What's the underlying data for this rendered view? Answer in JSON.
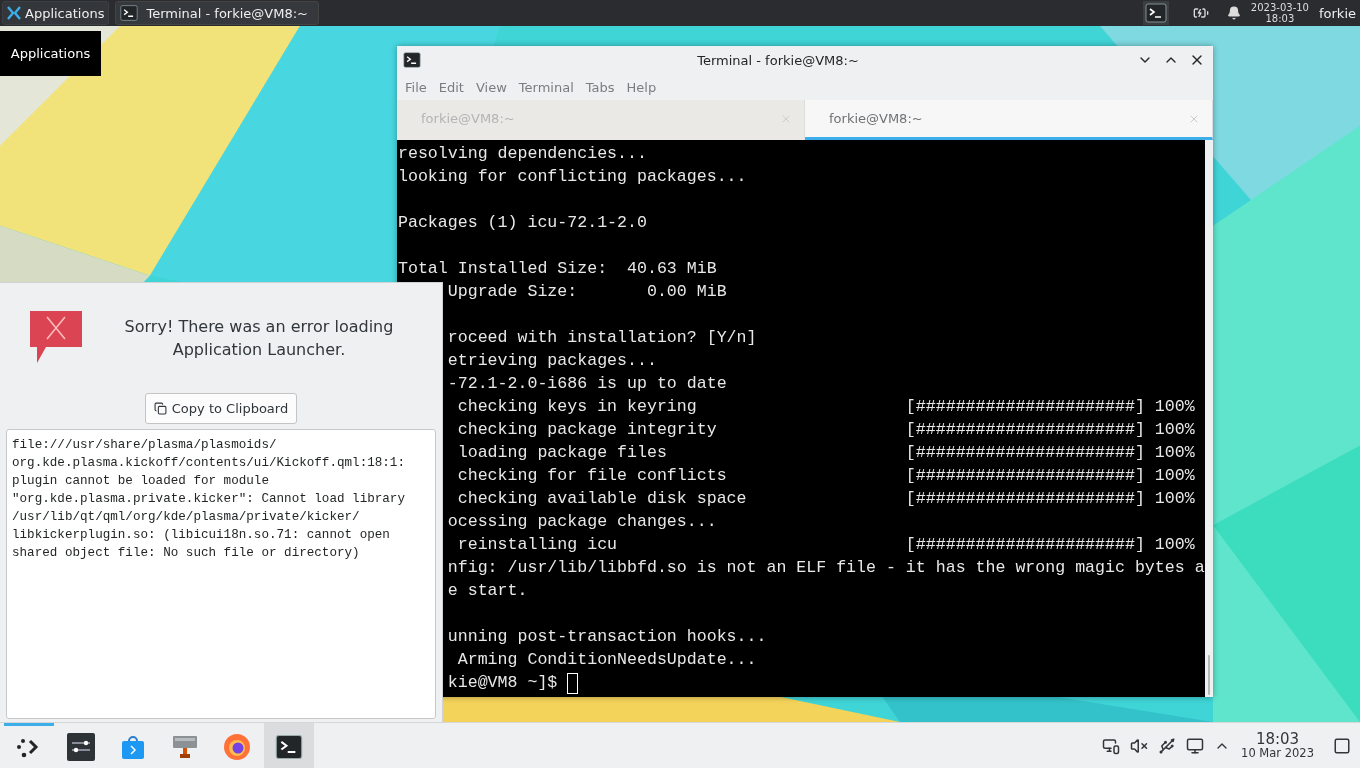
{
  "top_panel": {
    "app_menu": {
      "label": "Applications"
    },
    "tasks": [
      {
        "label": "Terminal - forkie@VM8:~",
        "selected": false
      }
    ],
    "tray_terminal": {
      "selected": true
    },
    "clock": {
      "date": "2023-03-10",
      "time": "18:03"
    },
    "user": "forkie"
  },
  "tooltip": {
    "text": "Applications"
  },
  "terminal_window": {
    "title": "Terminal - forkie@VM8:~",
    "menu": [
      "File",
      "Edit",
      "View",
      "Terminal",
      "Tabs",
      "Help"
    ],
    "tabs": [
      {
        "label": "forkie@VM8:~",
        "selected": false
      },
      {
        "label": "forkie@VM8:~",
        "selected": true
      }
    ],
    "output_blocks": [
      [
        "resolving dependencies...",
        "looking for conflicting packages..."
      ],
      [
        "Packages (1) icu-72.1-2.0"
      ],
      [
        "Total Installed Size:  40.63 MiB",
        "     Upgrade Size:       0.00 MiB"
      ],
      [
        "     roceed with installation? [Y/n]",
        "     etrieving packages...",
        "     -72.1-2.0-i686 is up to date",
        "      checking keys in keyring                     [######################] 100%",
        "      checking package integrity                   [######################] 100%",
        "      loading package files                        [######################] 100%",
        "      checking for file conflicts                  [######################] 100%",
        "      checking available disk space                [######################] 100%",
        "     ocessing package changes...",
        "      reinstalling icu                             [######################] 100%",
        "     nfig: /usr/lib/libbfd.so is not an ELF file - it has the wrong magic bytes a",
        "     e start."
      ],
      [
        "     unning post-transaction hooks...",
        "      Arming ConditionNeedsUpdate..."
      ]
    ],
    "prompt": "     kie@VM8 ~]$ "
  },
  "error_popup": {
    "message": "Sorry! There was an error loading Application Launcher.",
    "copy_button": "Copy to Clipboard",
    "details": [
      "file:///usr/share/plasma/plasmoids/",
      "org.kde.plasma.kickoff/contents/ui/Kickoff.qml:18:1:",
      "plugin cannot be loaded for module",
      "\"org.kde.plasma.private.kicker\": Cannot load library",
      "/usr/lib/qt/qml/org/kde/plasma/private/kicker/",
      "libkickerplugin.so: (libicui18n.so.71: cannot open",
      "shared object file: No such file or directory)"
    ]
  },
  "bottom_panel": {
    "launchers": [
      {
        "kind": "launcher",
        "selected": false,
        "active": true
      },
      {
        "kind": "settings",
        "selected": false,
        "active": false
      },
      {
        "kind": "store",
        "selected": false,
        "active": false
      },
      {
        "kind": "tool",
        "selected": false,
        "active": false
      },
      {
        "kind": "browser",
        "selected": false,
        "active": false
      },
      {
        "kind": "terminal",
        "selected": true,
        "active": false
      }
    ],
    "clock": {
      "time": "18:03",
      "date": "10 Mar 2023"
    }
  }
}
